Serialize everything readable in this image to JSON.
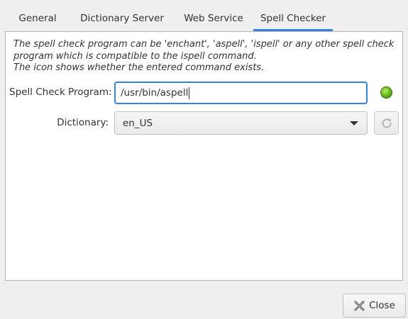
{
  "tabs": [
    {
      "label": "General"
    },
    {
      "label": "Dictionary Server"
    },
    {
      "label": "Web Service"
    },
    {
      "label": "Spell Checker"
    }
  ],
  "active_tab": "Spell Checker",
  "info": {
    "line1": "The spell check program can be 'enchant', 'aspell', 'ispell' or any other spell check",
    "line2": "program which is compatible to the ispell command.",
    "line3": "The icon shows whether the entered command exists."
  },
  "spell_check_program": {
    "label": "Spell Check Program:",
    "value": "/usr/bin/aspell",
    "status_icon": "green-status-light",
    "status_color": "#6fbf1e"
  },
  "dictionary": {
    "label": "Dictionary:",
    "selected": "en_US"
  },
  "refresh_button": {
    "icon": "refresh-icon"
  },
  "close_button": {
    "label": "Close",
    "icon": "close-icon"
  },
  "colors": {
    "accent": "#3584e4",
    "background": "#efefef",
    "panel": "#ffffff"
  }
}
